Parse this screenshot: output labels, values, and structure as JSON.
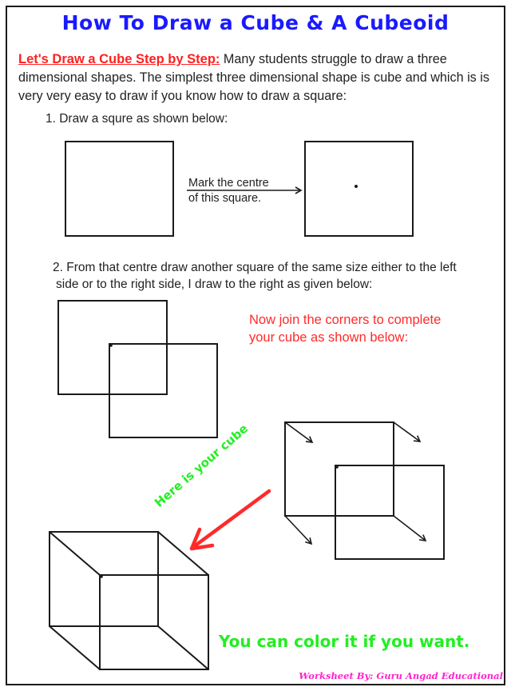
{
  "page": {
    "title": "How To Draw a Cube & A Cubeoid",
    "intro": {
      "lead": "Let's Draw a Cube Step by Step:",
      "text": " Many students struggle to draw a three dimensional shapes. The simplest three dimensional shape is cube and which is is very very easy to draw if you know how to draw a square:"
    },
    "steps": [
      {
        "label": "1. Draw a squre as shown below:"
      },
      {
        "label_line1": "2. From that centre draw another square of the same size either to the left",
        "label_line2": "side or to the right side, I draw to the right as given below:"
      }
    ],
    "annotations": {
      "mark_line1": "Mark the centre",
      "mark_line2": "of this square.",
      "join_line1": "Now join the corners to complete",
      "join_line2": "your cube as shown below:",
      "here_is_cube": "Here is your cube",
      "color_note": "You can color it if you want."
    },
    "footer": "Worksheet By: Guru Angad Educational",
    "colors": {
      "title": "#1a1aff",
      "lead": "#ff2020",
      "join_note": "#ff2a2a",
      "green_note": "#22ee22",
      "arrow_red": "#ff2a2a",
      "footer": "#ff22cc",
      "line": "#1a1a1a"
    }
  }
}
